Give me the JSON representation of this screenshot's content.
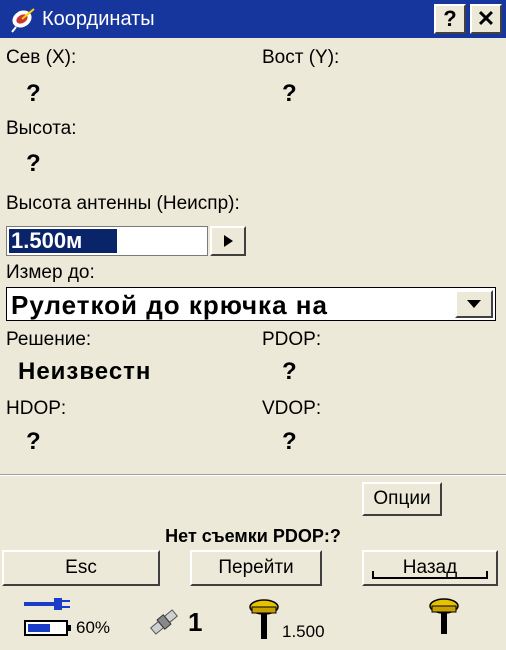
{
  "window": {
    "title": "Координаты",
    "help_label": "?",
    "close_label": "✕"
  },
  "fields": {
    "north": {
      "label": "Сев  (X):",
      "value": "?"
    },
    "east": {
      "label": "Вост (Y):",
      "value": "?"
    },
    "height": {
      "label": "Высота:",
      "value": "?"
    },
    "antenna": {
      "label": "Высота антенны (Неиспр):",
      "value": "1.500м"
    },
    "measure_to": {
      "label": "Измер до:",
      "value": "Рулеткой до крючка на"
    },
    "solution": {
      "label": "Решение:",
      "value": "Неизвестн"
    },
    "pdop": {
      "label": "PDOP:",
      "value": "?"
    },
    "hdop": {
      "label": "HDOP:",
      "value": "?"
    },
    "vdop": {
      "label": "VDOP:",
      "value": "?"
    }
  },
  "buttons": {
    "options": "Опции",
    "esc": "Esc",
    "goto": "Перейти",
    "back": "Назад"
  },
  "status": {
    "message": "Нет съемки PDOP:?"
  },
  "statusbar": {
    "battery_percent": "60%",
    "satellites": "1",
    "antenna_height": "1.500",
    "colors": {
      "title_bg": "#16369e",
      "power_blue": "#1a3cc8"
    },
    "icons": [
      "power-plug-icon",
      "battery-icon",
      "satellite-icon",
      "rover-antenna-icon",
      "receiver-icon"
    ]
  }
}
